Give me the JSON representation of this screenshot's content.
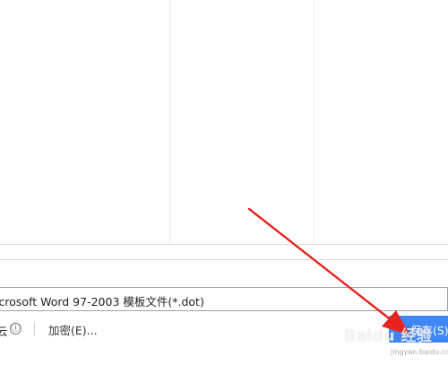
{
  "dialog": {
    "file_type": "icrosoft Word 97-2003 模板文件(*.dot)",
    "cloud_label": "云",
    "info_icon": "ⓘ",
    "encrypt_label": "加密(E)...",
    "save_label": "保存(S)"
  },
  "colors": {
    "accent": "#3d86f4",
    "arrow": "#e8231f"
  },
  "watermark": {
    "text": "Baidu 经验",
    "sub": "jingyan.baidu.com"
  }
}
